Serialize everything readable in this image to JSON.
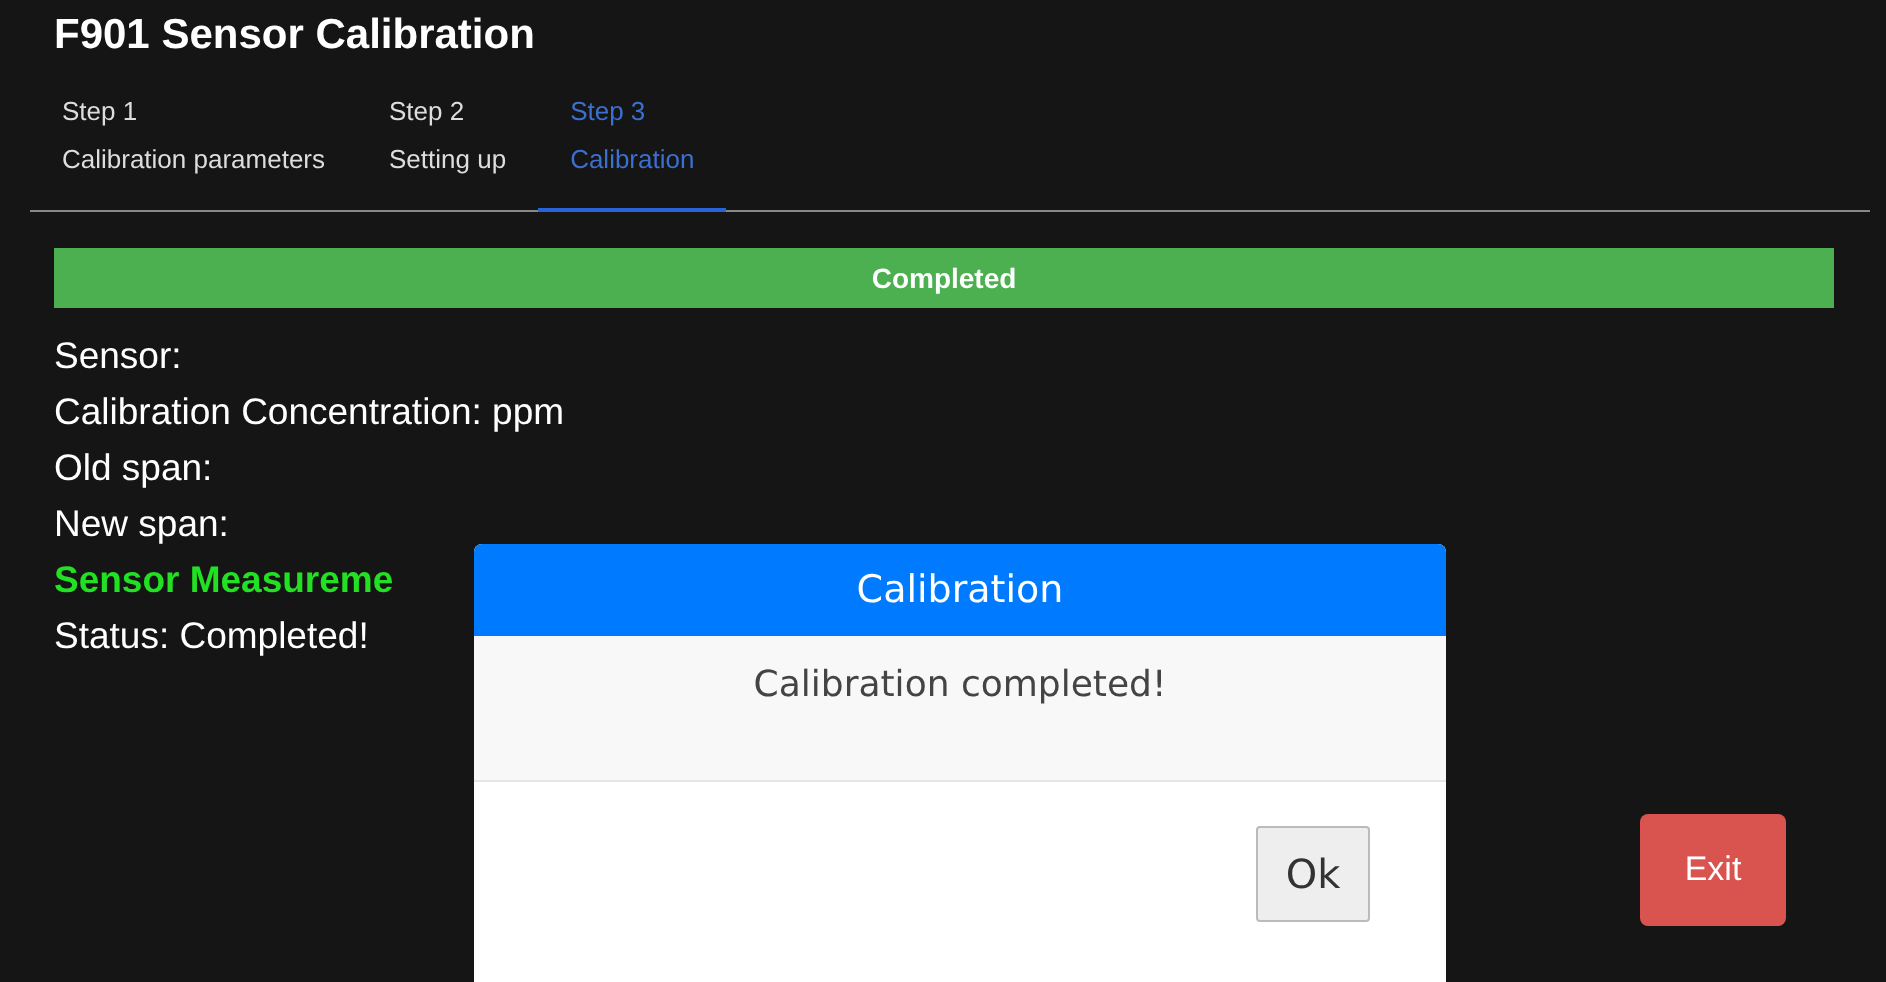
{
  "window": {
    "title": "F901 Sensor Calibration"
  },
  "tabs": [
    {
      "step": "Step 1",
      "label": "Calibration parameters",
      "selected": false
    },
    {
      "step": "Step 2",
      "label": "Setting up",
      "selected": false
    },
    {
      "step": "Step 3",
      "label": "Calibration",
      "selected": true
    }
  ],
  "progress": {
    "label": "Completed",
    "level": 1
  },
  "info_lines": [
    {
      "kind": "plain",
      "text": "Sensor:"
    },
    {
      "kind": "plain",
      "text": "Calibration Concentration: ppm"
    },
    {
      "kind": "plain",
      "text": "Old span:"
    },
    {
      "kind": "plain",
      "text": "New span:"
    },
    {
      "kind": "highlight",
      "text": "Sensor Measureme"
    },
    {
      "kind": "plain",
      "text": "Status: Completed!"
    }
  ],
  "exit_button": "Exit",
  "dialog": {
    "title": "Calibration",
    "message": "Calibration completed!",
    "button": "Ok"
  }
}
